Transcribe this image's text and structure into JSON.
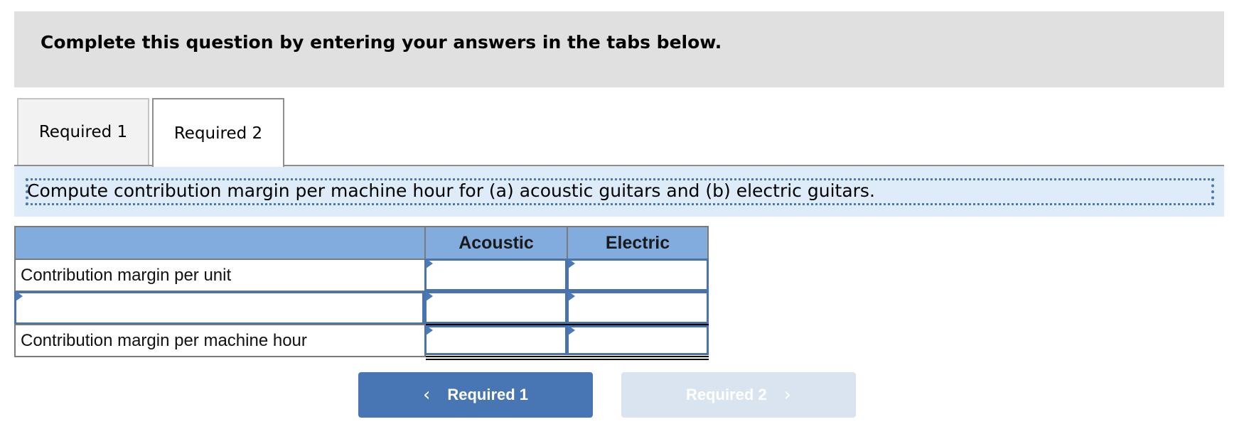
{
  "header": {
    "title": "Complete this question by entering your answers in the tabs below."
  },
  "tabs": [
    {
      "label": "Required 1",
      "active": false
    },
    {
      "label": "Required 2",
      "active": true
    }
  ],
  "instruction": "Compute contribution margin per machine hour for (a) acoustic guitars and (b) electric guitars.",
  "table": {
    "columns": [
      "",
      "Acoustic",
      "Electric"
    ],
    "rows": [
      {
        "label": "Contribution margin per unit",
        "label_editable": false,
        "values": [
          "",
          ""
        ]
      },
      {
        "label": "",
        "label_editable": true,
        "values": [
          "",
          ""
        ]
      },
      {
        "label": "Contribution margin per machine hour",
        "label_editable": false,
        "values": [
          "",
          ""
        ]
      }
    ]
  },
  "nav": {
    "prev_label": "Required 1",
    "next_label": "Required 2",
    "prev_icon": "chevron-left-icon",
    "next_icon": "chevron-right-icon",
    "next_disabled": true
  },
  "colors": {
    "header_bg": "#e0e0e0",
    "instruction_bg": "#deebf8",
    "table_header_bg": "#82acdd",
    "input_border": "#4a72ad",
    "primary_button": "#4876b4",
    "disabled_button": "#dae4f0"
  }
}
